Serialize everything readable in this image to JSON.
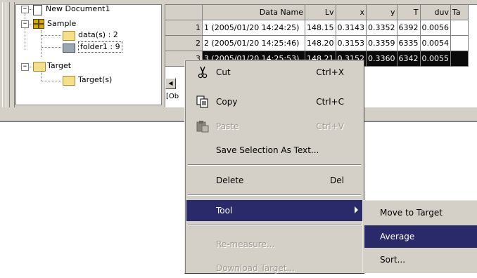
{
  "tree": {
    "root": "New Document1",
    "sample": "Sample",
    "data_item": "data(s) : 2",
    "folder_item": "folder1 : 9",
    "target": "Target",
    "target_item": "Target(s)"
  },
  "grid": {
    "columns": [
      "",
      "Data Name",
      "Lv",
      "x",
      "y",
      "T",
      "duv",
      "Ta"
    ],
    "rows": [
      {
        "n": "1",
        "name": "1 (2005/01/20 14:24:25)",
        "lv": "148.15",
        "x": "0.3143",
        "y": "0.3352",
        "t": "6392",
        "duv": "0.0056"
      },
      {
        "n": "2",
        "name": "2 (2005/01/20 14:25:46)",
        "lv": "148.20",
        "x": "0.3153",
        "y": "0.3359",
        "t": "6335",
        "duv": "0.0054"
      },
      {
        "n": "3",
        "name": "3 (2005/01/20 14:25:53)",
        "lv": "148.21",
        "x": "0.3152",
        "y": "0.3360",
        "t": "6342",
        "duv": "0.0055"
      }
    ],
    "status": "[Ob"
  },
  "context_menu": {
    "cut": {
      "label": "Cut",
      "shortcut": "Ctrl+X"
    },
    "copy": {
      "label": "Copy",
      "shortcut": "Ctrl+C"
    },
    "paste": {
      "label": "Paste",
      "shortcut": "Ctrl+V"
    },
    "save_selection": {
      "label": "Save Selection As Text..."
    },
    "delete": {
      "label": "Delete",
      "shortcut": "Del"
    },
    "tool": {
      "label": "Tool"
    },
    "remeasure": {
      "label": "Re-measure..."
    },
    "download": {
      "label": "Download Target..."
    }
  },
  "submenu": {
    "move": "Move to Target",
    "average": "Average",
    "sort": "Sort..."
  },
  "colors": {
    "highlight": "#2a2a6a",
    "selected_row": "#0a0a0a",
    "face": "#d4d0c8"
  }
}
